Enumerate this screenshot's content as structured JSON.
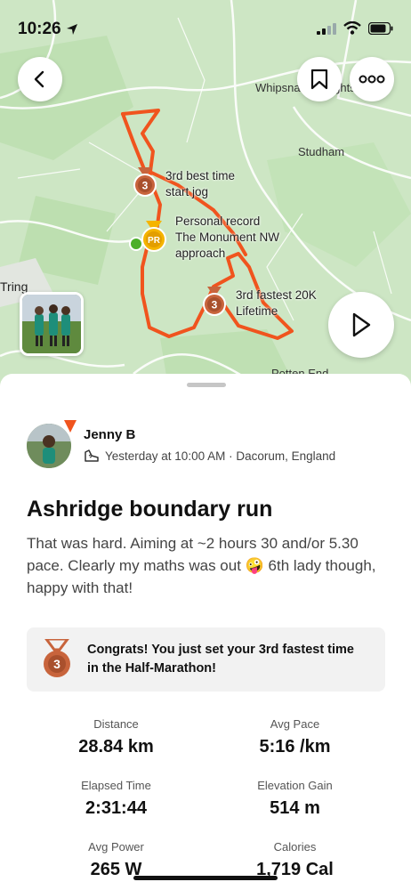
{
  "status": {
    "time": "10:26",
    "icons": [
      "location-arrow-icon",
      "signal-icon",
      "wifi-icon",
      "battery-icon"
    ]
  },
  "map": {
    "place_labels": {
      "whipsnade": "Whipsnade Heights",
      "studham": "Studham",
      "tring": "Tring",
      "potten_end": "Potten End"
    },
    "segments": [
      {
        "badge": "3",
        "label": "3rd best time\nstart jog",
        "line1": "3rd best time",
        "line2": "start jog"
      },
      {
        "badge": "PR",
        "line1": "Personal record",
        "line2": "The Monument NW",
        "line3": "approach"
      },
      {
        "badge": "3",
        "line1": "3rd fastest 20K",
        "line2": "Lifetime"
      }
    ],
    "route_color": "#f0541e",
    "medal_color": "#c8643c",
    "pr_color": "#f5b400"
  },
  "athlete": {
    "name": "Jenny B",
    "meta": "Yesterday at 10:00 AM · Dacorum, England"
  },
  "activity": {
    "title": "Ashridge boundary run",
    "description": "That was hard. Aiming at ~2 hours 30 and/or 5.30 pace. Clearly my maths was out 🤪 6th lady though, happy with that!"
  },
  "achievement": {
    "line1": "Congrats! You just set your 3rd fastest time",
    "line2": "in the Half-Marathon!",
    "badge": "3"
  },
  "stats": [
    {
      "label": "Distance",
      "value": "28.84 km"
    },
    {
      "label": "Avg Pace",
      "value": "5:16 /km"
    },
    {
      "label": "Elapsed Time",
      "value": "2:31:44"
    },
    {
      "label": "Elevation Gain",
      "value": "514 m"
    },
    {
      "label": "Avg Power",
      "value": "265 W"
    },
    {
      "label": "Calories",
      "value": "1,719 Cal"
    }
  ]
}
